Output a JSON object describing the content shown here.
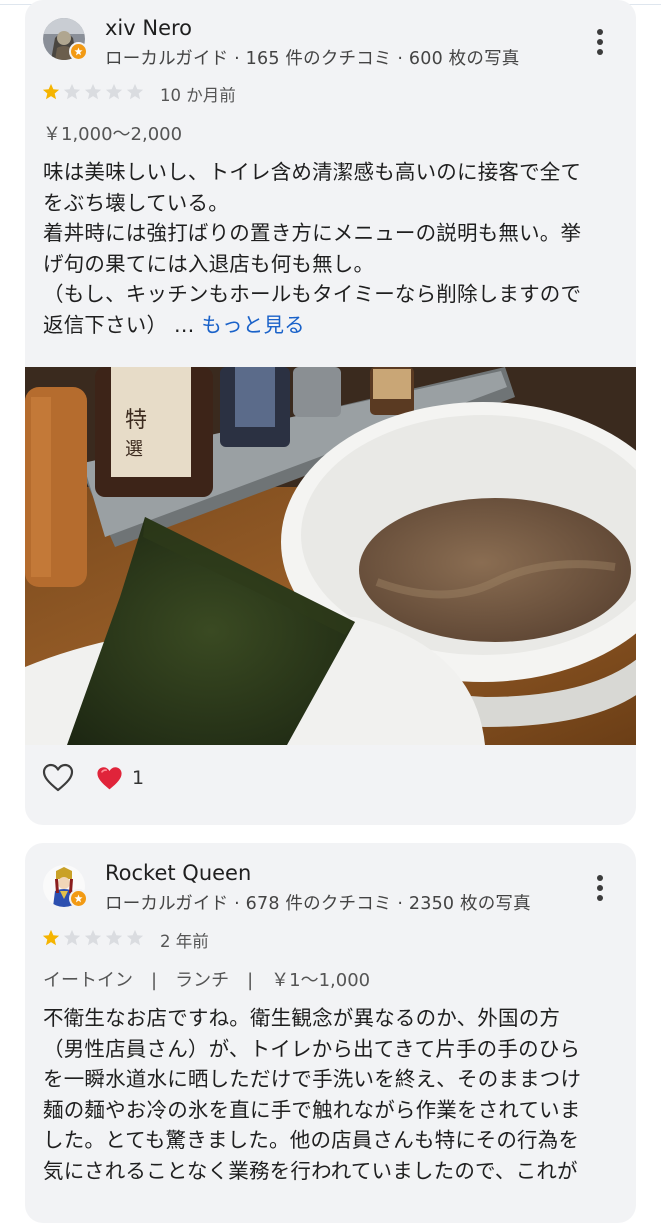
{
  "reviews": [
    {
      "author": "xiv Nero",
      "author_meta": "ローカルガイド · 165 件のクチコミ · 600 枚の写真",
      "rating": 1,
      "rating_max": 5,
      "relative_time": "10 か月前",
      "price": "￥1,000～2,000",
      "text": "味は美味しいし、トイレ含め清潔感も高いのに接客で全て\nをぶち壊している。\n着丼時には強打ばりの置き方にメニューの説明も無い。挙\nげ句の果てには入退店も何も無し。\n（もし、キッチンもホールもタイミーなら削除しますので\n返信下さい）",
      "ellipsis": " … ",
      "more_label": "もっと見る",
      "like_count": "1",
      "photo_icon": "tsukemen-photo"
    },
    {
      "author": "Rocket Queen",
      "author_meta": "ローカルガイド · 678 件のクチコミ · 2350 枚の写真",
      "rating": 1,
      "rating_max": 5,
      "relative_time": "2 年前",
      "tags": "イートイン　|　ランチ　|　￥1～1,000",
      "text": "不衛生なお店ですね。衛生観念が異なるのか、外国の方\n（男性店員さん）が、トイレから出てきて片手の手のひら\nを一瞬水道水に晒しただけで手洗いを終え、そのままつけ\n麺の麺やお冷の氷を直に手で触れながら作業をされていま\nした。とても驚きました。他の店員さんも特にその行為を\n気にされることなく業務を行われていましたので、これが"
    }
  ],
  "colors": {
    "card_bg": "#f2f3f5",
    "star_filled": "#f5b400",
    "star_empty": "#dadce0",
    "link": "#1a62c9",
    "heart": "#e0243a"
  }
}
